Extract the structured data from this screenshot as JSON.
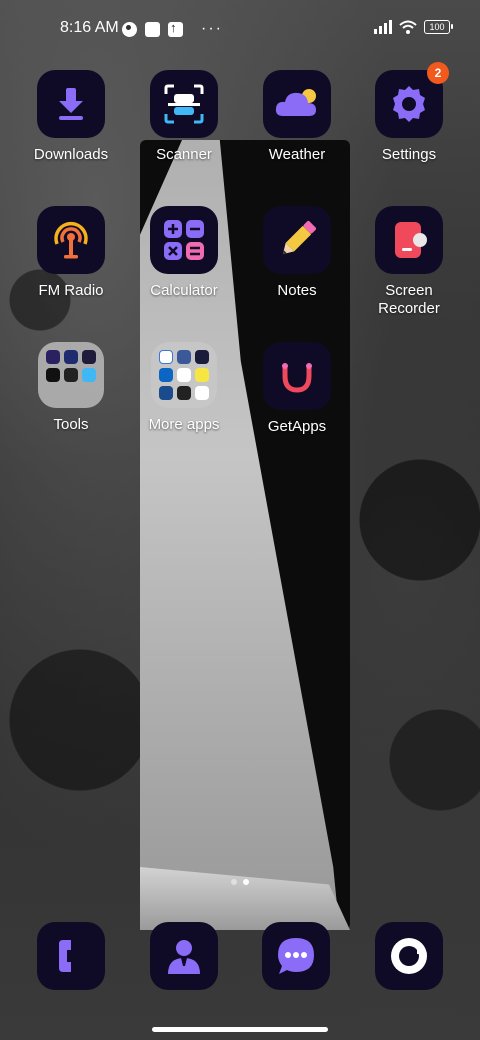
{
  "status_bar": {
    "time": "8:16 AM",
    "battery": "100",
    "icons": [
      "notification-circle-icon",
      "square-icon",
      "upload-icon",
      "more-dots-icon",
      "signal-icon",
      "wifi-icon",
      "battery-icon"
    ],
    "more": "···"
  },
  "apps": [
    {
      "label": "Downloads",
      "icon": "download-icon"
    },
    {
      "label": "Scanner",
      "icon": "scanner-icon"
    },
    {
      "label": "Weather",
      "icon": "weather-cloud-icon"
    },
    {
      "label": "Settings",
      "icon": "gear-icon",
      "badge": "2"
    },
    {
      "label": "FM Radio",
      "icon": "radio-icon"
    },
    {
      "label": "Calculator",
      "icon": "calculator-icon"
    },
    {
      "label": "Notes",
      "icon": "pencil-icon"
    },
    {
      "label": "Screen Recorder",
      "icon": "screen-recorder-icon"
    },
    {
      "label": "Tools",
      "icon": "folder-icon"
    },
    {
      "label": "More apps",
      "icon": "folder-icon"
    },
    {
      "label": "GetApps",
      "icon": "getapps-icon"
    }
  ],
  "dock": [
    {
      "icon": "phone-icon"
    },
    {
      "icon": "contacts-icon"
    },
    {
      "icon": "messages-icon"
    },
    {
      "icon": "camera-icon"
    }
  ],
  "page_indicator": {
    "pages": 2,
    "active": 1
  },
  "colors": {
    "icon_bg": "#0f0b26",
    "accent_purple": "#8b6cf6",
    "badge": "#f25a1d"
  }
}
